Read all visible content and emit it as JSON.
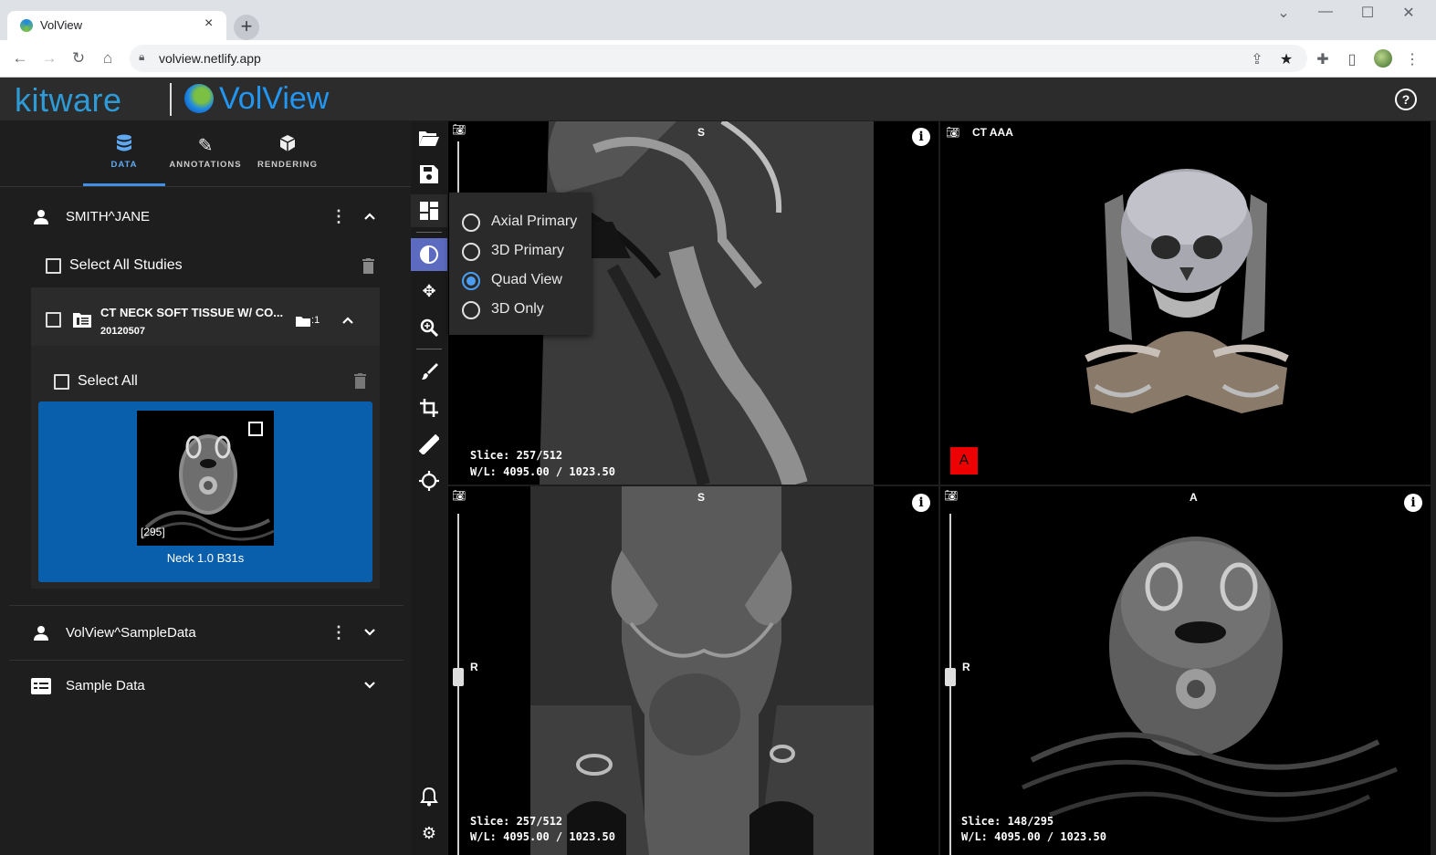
{
  "browser": {
    "tab_title": "VolView",
    "tab_close": "×",
    "new_tab": "+",
    "url": "volview.netlify.app",
    "window_controls": [
      "⌄",
      "—",
      "☐",
      "✕"
    ]
  },
  "header": {
    "brand1": "kitware",
    "brand2": "VolView",
    "help": "?"
  },
  "panel_tabs": [
    {
      "label": "DATA",
      "icon": "database-icon"
    },
    {
      "label": "ANNOTATIONS",
      "icon": "pencil-icon"
    },
    {
      "label": "RENDERING",
      "icon": "cube-icon"
    }
  ],
  "patients": [
    {
      "name": "SMITH^JANE",
      "select_all_studies": "Select All Studies",
      "study": {
        "title": "CT NECK SOFT TISSUE W/ CO...",
        "date": "20120507",
        "series_count": "1",
        "select_all": "Select All",
        "series": [
          {
            "label": "Neck 1.0 B31s",
            "slices": "[295]"
          }
        ]
      }
    },
    {
      "name": "VolView^SampleData"
    }
  ],
  "sample_data": {
    "label": "Sample Data"
  },
  "layout_menu": {
    "options": [
      "Axial Primary",
      "3D Primary",
      "Quad View",
      "3D Only"
    ],
    "selected": "Quad View"
  },
  "views": {
    "sagittal": {
      "orientation": "S",
      "slice": "Slice: 257/512",
      "wl": "W/L: 4095.00 / 1023.50"
    },
    "threed": {
      "title": "CT AAA",
      "orient_badge": "A"
    },
    "coronal": {
      "orientation": "S",
      "side": "R",
      "slice": "Slice: 257/512",
      "wl": "W/L: 4095.00 / 1023.50"
    },
    "axial": {
      "orientation": "A",
      "side": "R",
      "slice": "Slice: 148/295",
      "wl": "W/L: 4095.00 / 1023.50"
    }
  },
  "colors": {
    "accent": "#3f8fe6",
    "selected_series": "#0a5fad",
    "active_tool": "#5c6bc0",
    "orient_badge": "#e00000"
  }
}
